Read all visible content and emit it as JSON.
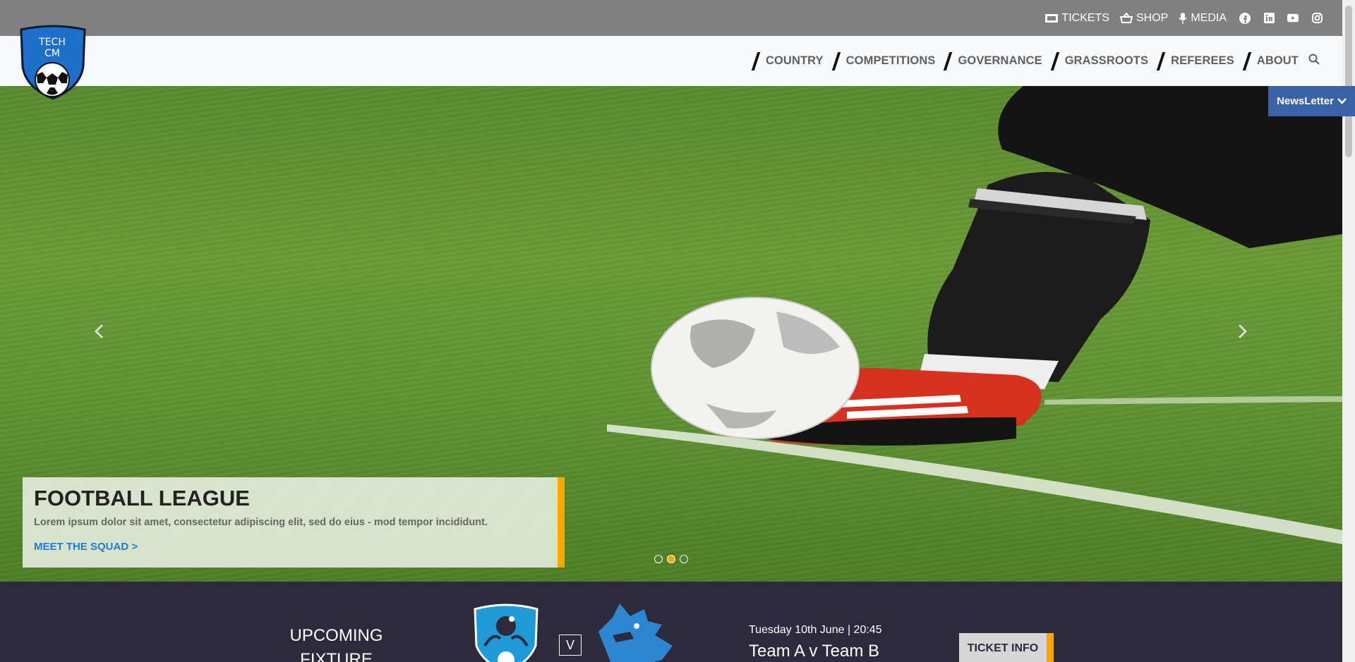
{
  "topbar": {
    "tickets": "TICKETS",
    "shop": "SHOP",
    "media": "MEDIA",
    "social_icons": [
      "facebook-icon",
      "linkedin-icon",
      "youtube-icon",
      "instagram-icon"
    ]
  },
  "logo": {
    "line1": "TECH",
    "line2": "CM"
  },
  "nav": {
    "items": [
      "COUNTRY",
      "COMPETITIONS",
      "GOVERNANCE",
      "GRASSROOTS",
      "REFEREES",
      "ABOUT"
    ]
  },
  "newsletter": {
    "label": "NewsLetter"
  },
  "hero": {
    "title": "FOOTBALL LEAGUE",
    "text": "Lorem ipsum dolor sit amet, consectetur adipiscing elit, sed do eius - mod tempor incididunt.",
    "link": "MEET THE SQUAD >",
    "slides": 3,
    "active_slide": 2
  },
  "fixture": {
    "label": "UPCOMING FIXTURE",
    "vs": "V",
    "date": "Tuesday 10th June | 20:45",
    "match": "Team A v Team B",
    "button": "TICKET INFO"
  },
  "colors": {
    "accent": "#ffa500",
    "link": "#1a7ed8",
    "newsletter": "#3a62a7",
    "band": "#2d2a3d"
  }
}
